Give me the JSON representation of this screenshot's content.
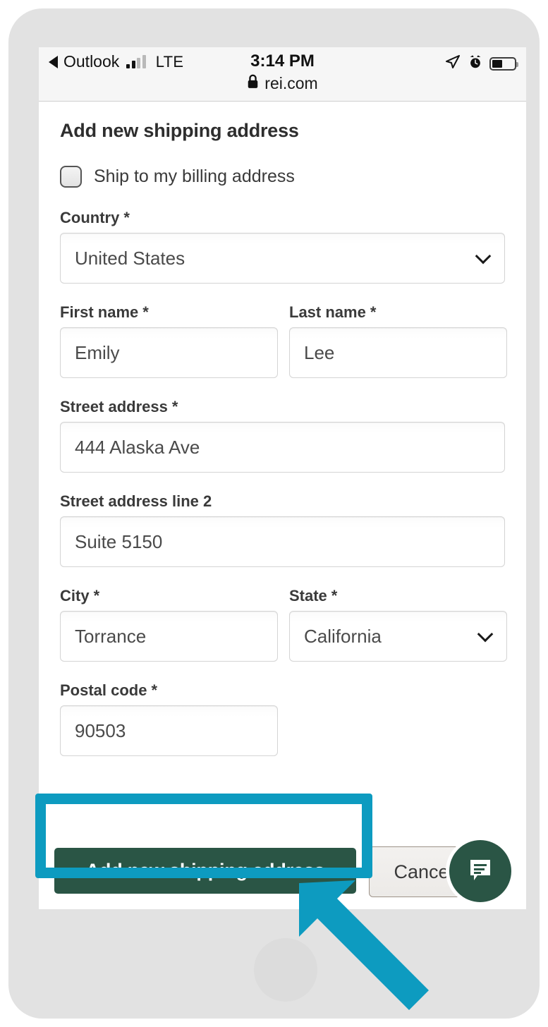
{
  "status_bar": {
    "back_app": "Outlook",
    "network": "LTE",
    "time": "3:14 PM",
    "url": "rei.com",
    "lock_icon": "🔒",
    "icons": [
      "location-arrow-icon",
      "alarm-clock-icon",
      "battery-icon"
    ],
    "signal_bars_filled": 2,
    "signal_bars_total": 4,
    "battery_level_percent": 46
  },
  "page": {
    "title": "Add new shipping address"
  },
  "billing_checkbox": {
    "label": "Ship to my billing address",
    "checked": false
  },
  "fields": {
    "country": {
      "label": "Country",
      "required": "*",
      "value": "United States",
      "type": "select"
    },
    "first_name": {
      "label": "First name",
      "required": "*",
      "value": "Emily",
      "type": "text"
    },
    "last_name": {
      "label": "Last name",
      "required": "*",
      "value": "Lee",
      "type": "text"
    },
    "street_address": {
      "label": "Street address",
      "required": "*",
      "value": "444 Alaska Ave",
      "type": "text"
    },
    "street_address_2": {
      "label": "Street address line 2",
      "required": "",
      "value": "Suite 5150",
      "type": "text"
    },
    "city": {
      "label": "City",
      "required": "*",
      "value": "Torrance",
      "type": "text"
    },
    "state": {
      "label": "State",
      "required": "*",
      "value": "California",
      "type": "select"
    },
    "postal_code": {
      "label": "Postal code",
      "required": "*",
      "value": "90503",
      "type": "text"
    }
  },
  "actions": {
    "primary_label": "Add new shipping address",
    "cancel_label": "Cancel"
  },
  "chat": {
    "icon": "chat-bubble-icon"
  },
  "annotation": {
    "highlight_color": "#0d9bc0",
    "arrow_color": "#0d9bc0",
    "target": "Add new shipping address"
  },
  "colors": {
    "brand_green": "#2a5545",
    "accent_teal": "#0d9bc0",
    "frame_gray": "#e2e2e2",
    "status_bar_bg": "#f6f6f6"
  }
}
